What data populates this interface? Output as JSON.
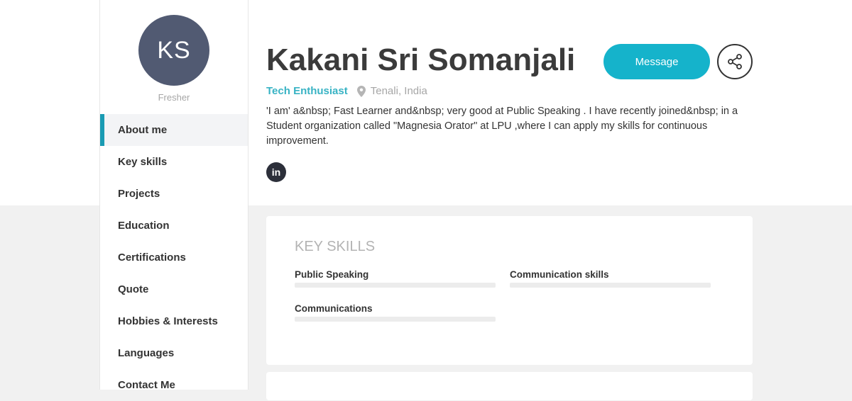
{
  "profile": {
    "initials": "KS",
    "status": "Fresher",
    "name": "Kakani Sri Somanjali",
    "tagline": "Tech Enthusiast",
    "location": "Tenali, India",
    "about": "'I am' a&nbsp; Fast Learner and&nbsp; very good at Public Speaking . I have recently joined&nbsp; in a Student organization called \"Magnesia Orator\" at LPU ,where I can apply my skills for continuous improvement."
  },
  "actions": {
    "message_label": "Message",
    "linkedin_label": "in"
  },
  "nav": {
    "items": [
      {
        "label": "About me",
        "active": true
      },
      {
        "label": "Key skills"
      },
      {
        "label": "Projects"
      },
      {
        "label": "Education"
      },
      {
        "label": "Certifications"
      },
      {
        "label": "Quote"
      },
      {
        "label": "Hobbies & Interests"
      },
      {
        "label": "Languages"
      },
      {
        "label": "Contact Me"
      }
    ]
  },
  "skills_card": {
    "title": "KEY SKILLS",
    "skills": [
      {
        "name": "Public Speaking"
      },
      {
        "name": "Communication skills"
      },
      {
        "name": "Communications"
      }
    ]
  },
  "colors": {
    "accent": "#15b3cb",
    "avatar_bg": "#515a72",
    "tagline": "#38b3c4"
  },
  "icons": [
    "share-icon",
    "location-pin-icon",
    "linkedin-icon"
  ]
}
